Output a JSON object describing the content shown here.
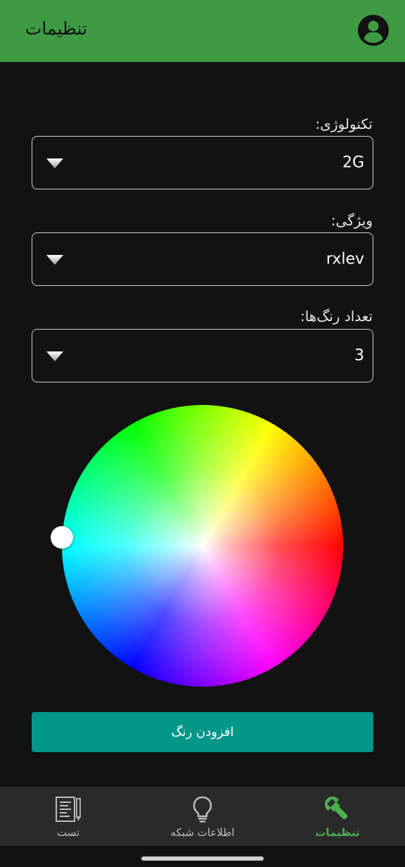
{
  "appbar": {
    "title": "تنظیمات",
    "account_icon": "account-circle-icon"
  },
  "form": {
    "technology": {
      "label": "تکنولوژی:",
      "value": "2G"
    },
    "feature": {
      "label": "ویژگی:",
      "value": "rxlev"
    },
    "color_count": {
      "label": "تعداد رنگ‌ها:",
      "value": "3"
    }
  },
  "add_color_button": {
    "label": "افزودن رنگ"
  },
  "bottom_nav": {
    "items": [
      {
        "label": "تنظیمات",
        "icon": "wrench-icon",
        "active": true
      },
      {
        "label": "اطلاعات شبکه",
        "icon": "lightbulb-icon",
        "active": false
      },
      {
        "label": "تست",
        "icon": "document-icon",
        "active": false
      }
    ]
  },
  "colors": {
    "appbar": "#3f9a44",
    "background": "#121212",
    "button": "#009688",
    "nav_active": "#4caf50",
    "nav_inactive": "#bdbdbd"
  }
}
